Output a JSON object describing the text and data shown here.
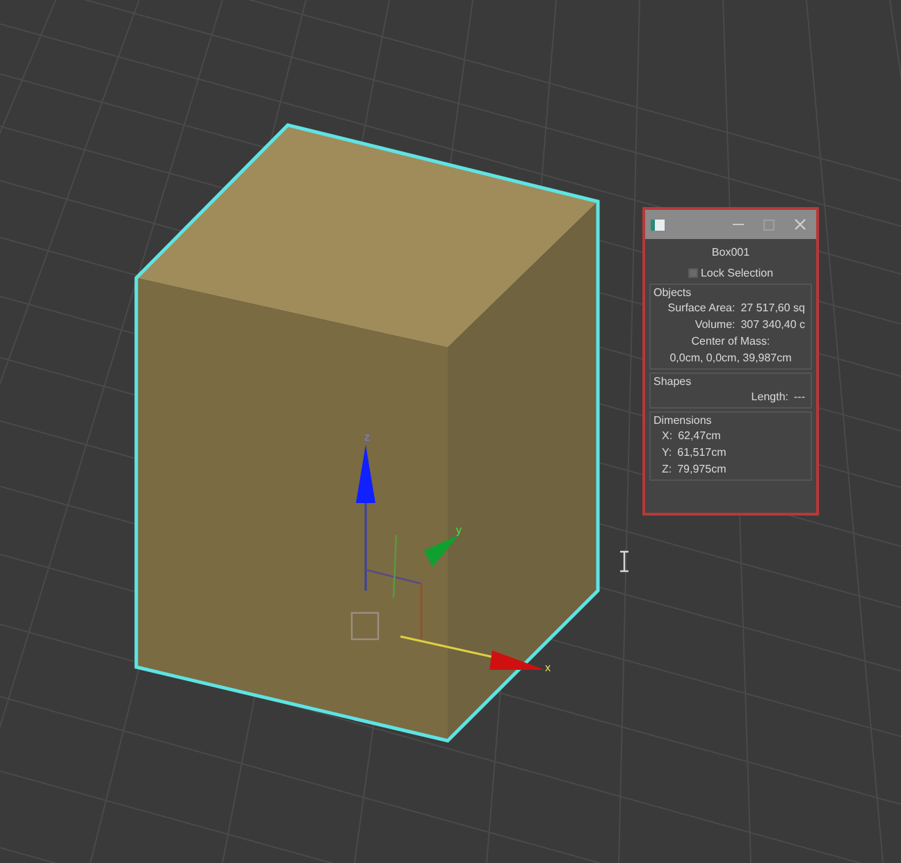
{
  "viewport": {
    "axis_labels": [
      "z",
      "y",
      "x"
    ]
  },
  "dialog": {
    "title": "Box001",
    "lock_selection": {
      "label": "Lock Selection",
      "checked": false
    },
    "sections": [
      {
        "heading": "Objects",
        "rows": [
          {
            "kind": "pair",
            "label": "Surface Area:",
            "value": "27 517,60 sq"
          },
          {
            "kind": "pair",
            "label": "Volume:",
            "value": "307 340,40 c"
          },
          {
            "kind": "center",
            "text": "Center of Mass:"
          },
          {
            "kind": "center",
            "text": "0,0cm, 0,0cm, 39,987cm"
          }
        ]
      },
      {
        "heading": "Shapes",
        "rows": [
          {
            "kind": "pair",
            "label": "Length:",
            "value": "---"
          }
        ]
      },
      {
        "heading": "Dimensions",
        "rows": [
          {
            "kind": "left",
            "label": "X:",
            "value": "62,47cm"
          },
          {
            "kind": "left",
            "label": "Y:",
            "value": "61,517cm"
          },
          {
            "kind": "left",
            "label": "Z:",
            "value": "79,975cm"
          }
        ]
      }
    ]
  }
}
